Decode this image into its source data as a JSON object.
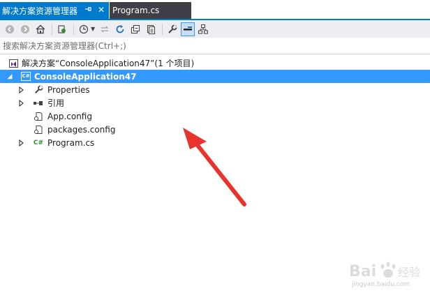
{
  "tabs": {
    "active_label": "解决方案资源管理器",
    "pin_glyph": "ꟷ",
    "close_glyph": "✕",
    "inactive_label": "Program.cs"
  },
  "toolbar": {
    "buttons": [
      {
        "name": "back-icon",
        "glyph": "◀"
      },
      {
        "name": "forward-icon",
        "glyph": "▶"
      },
      {
        "name": "home-icon",
        "glyph": "⌂"
      },
      {
        "name": "sync-with-active-document-icon",
        "glyph": "⇄"
      },
      {
        "name": "pending-changes-filter-icon",
        "glyph": "◷"
      },
      {
        "name": "sync-icon",
        "glyph": "⇆"
      },
      {
        "name": "refresh-icon",
        "glyph": "↻"
      },
      {
        "name": "collapse-all-icon",
        "glyph": "⧉"
      },
      {
        "name": "show-all-files-icon",
        "glyph": "▣"
      },
      {
        "name": "properties-icon",
        "glyph": "🔧"
      },
      {
        "name": "preview-selected-items-icon",
        "glyph": "▬"
      },
      {
        "name": "class-diagram-icon",
        "glyph": "品"
      }
    ]
  },
  "search": {
    "placeholder": "搜索解决方案资源管理器(Ctrl+;)"
  },
  "tree": {
    "solution_label": "解决方案“ConsoleApplication47”(1 个项目)",
    "project_label": "ConsoleApplication47",
    "project_icon_text": "C#",
    "items": [
      {
        "label": "Properties",
        "icon": "wrench-icon",
        "glyph": "🔧",
        "expandable": true
      },
      {
        "label": "引用",
        "icon": "references-icon",
        "glyph": "■■",
        "expandable": true
      },
      {
        "label": "App.config",
        "icon": "config-file-icon",
        "glyph": "⎘",
        "expandable": false
      },
      {
        "label": "packages.config",
        "icon": "config-file-icon",
        "glyph": "⎘",
        "expandable": false
      },
      {
        "label": "Program.cs",
        "icon": "csharp-file-icon",
        "glyph": "C#",
        "expandable": true
      }
    ]
  },
  "watermark": {
    "brand": "Bai 经验",
    "url": "jingyan.baidu.com"
  },
  "colors": {
    "accent": "#007acc",
    "selection": "#3399ff",
    "annotation": "#e8342c"
  }
}
